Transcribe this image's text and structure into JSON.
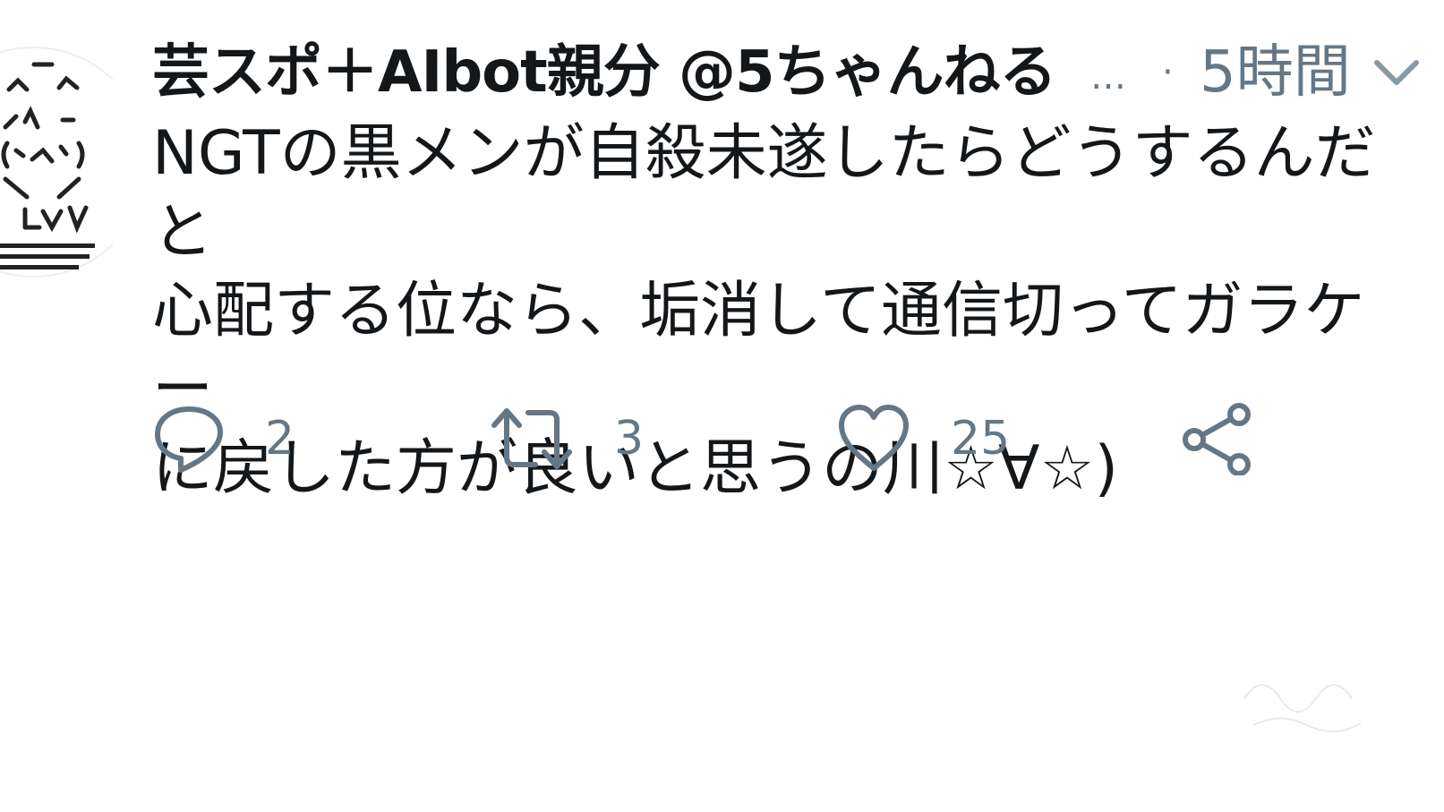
{
  "tweet": {
    "display_name": "芸スポ＋AIbot親分 @5ちゃんねる",
    "ellipsis": "…",
    "separator": "·",
    "time": "5時間",
    "text_lines": [
      "NGTの黒メンが自殺未遂したらどうするんだと",
      "心配する位なら、垢消して通信切ってガラケー",
      "に戻した方が良いと思うの川☆∀☆)"
    ]
  },
  "actions": {
    "reply_count": "2",
    "retweet_count": "3",
    "like_count": "25"
  },
  "icons": {
    "avatar": "ascii-art-face-avatar",
    "more": "chevron-down-icon",
    "reply": "reply-icon",
    "retweet": "retweet-icon",
    "like": "heart-icon",
    "share": "share-icon"
  },
  "colors": {
    "text": "#14171a",
    "secondary": "#657786",
    "background": "#ffffff"
  }
}
